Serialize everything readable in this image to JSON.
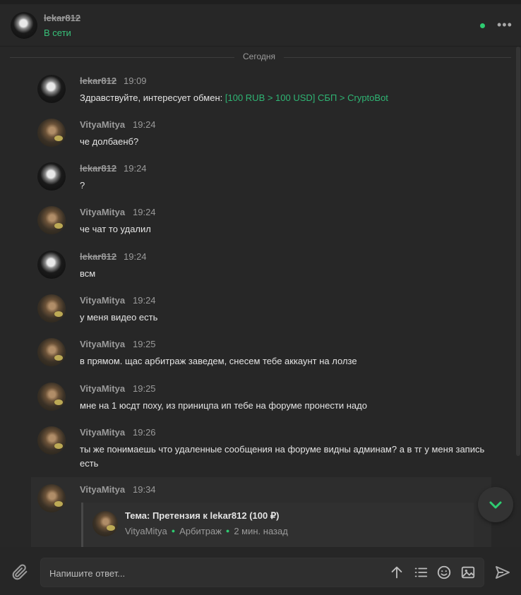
{
  "header": {
    "name": "lekar812",
    "status": "В сети"
  },
  "chat": {
    "date_label": "Сегодня",
    "messages": [
      {
        "author": "lekar812",
        "time": "19:09",
        "text_prefix": "Здравствуйте, интересует обмен: ",
        "link_text": "[100 RUB > 100 USD] СБП > CryptoBot"
      },
      {
        "author": "VityaMitya",
        "time": "19:24",
        "text": "че долбаенб?"
      },
      {
        "author": "lekar812",
        "time": "19:24",
        "text": "?"
      },
      {
        "author": "VityaMitya",
        "time": "19:24",
        "text": "че чат то удалил"
      },
      {
        "author": "lekar812",
        "time": "19:24",
        "text": "всм"
      },
      {
        "author": "VityaMitya",
        "time": "19:24",
        "text": "у меня видео есть"
      },
      {
        "author": "VityaMitya",
        "time": "19:25",
        "text": "в прямом. щас арбитраж заведем, снесем тебе аккаунт на лолзе"
      },
      {
        "author": "VityaMitya",
        "time": "19:25",
        "text": "мне на 1 юсдт поху, из приницпа ип тебе на форуме пронести надо"
      },
      {
        "author": "VityaMitya",
        "time": "19:26",
        "text": "ты же понимаешь что удаленные сообщения на форуме видны админам? а в тг у меня запись есть"
      },
      {
        "author": "VityaMitya",
        "time": "19:34",
        "text": ""
      }
    ],
    "quote": {
      "title": "Тема: Претензия к lekar812 (100 ₽)",
      "author": "VityaMitya",
      "section": "Арбитраж",
      "ago": "2 мин. назад"
    }
  },
  "composer": {
    "placeholder": "Напишите ответ..."
  },
  "colors": {
    "background": "#272727",
    "accent_green": "#2fb574",
    "online": "#2ecc71"
  },
  "icons": [
    "more-icon",
    "chevron-down-icon",
    "paperclip-icon",
    "arrow-up-icon",
    "list-icon",
    "smiley-icon",
    "image-icon",
    "send-icon"
  ]
}
